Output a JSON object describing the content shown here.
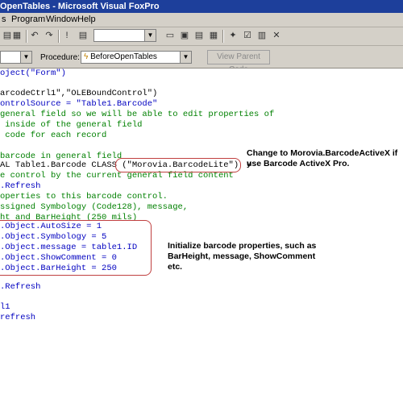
{
  "window": {
    "title": "OpenTables - Microsoft Visual FoxPro"
  },
  "menu": {
    "items": [
      "s",
      "Program",
      "Window",
      "Help"
    ]
  },
  "objectbar": {
    "procedure_label": "Procedure:",
    "procedure_value": "BeforeOpenTables",
    "view_parent_label": "View Parent Code"
  },
  "code": {
    "lines": [
      "oject(\"Form\")",
      "",
      "arcodeCtrl1\",\"OLEBoundControl\")",
      "ontrolSource = \"Table1.Barcode\"",
      "general field so we will be able to edit properties of",
      " inside of the general field",
      " code for each record",
      "",
      "barcode in general field",
      "AL Table1.Barcode CLASS (\"Morovia.BarcodeLite\")",
      "e control by the current general field content",
      ".Refresh",
      "operties to this barcode control.",
      "ssigned Symbology (Code128), message,",
      "ht and BarHeight (250 mils)",
      ".Object.AutoSize = 1",
      ".Object.Symbology = 5",
      ".Object.message = table1.ID",
      ".Object.ShowComment = 0",
      ".Object.BarHeight = 250",
      "",
      ".Refresh",
      "",
      "l1",
      "refresh"
    ]
  },
  "notes": {
    "note1": "Change to Morovia.BarcodeActiveX if y",
    "note1b": "use Barcode ActiveX Pro.",
    "note2a": "Initialize barcode properties, such as",
    "note2b": "BarHeight, message, ShowComment",
    "note2c": "etc."
  },
  "colors": {
    "keyword": "#0000c0",
    "comment": "#008000",
    "titlebar": "#1d3f9b",
    "annotation_border": "#c04040"
  }
}
